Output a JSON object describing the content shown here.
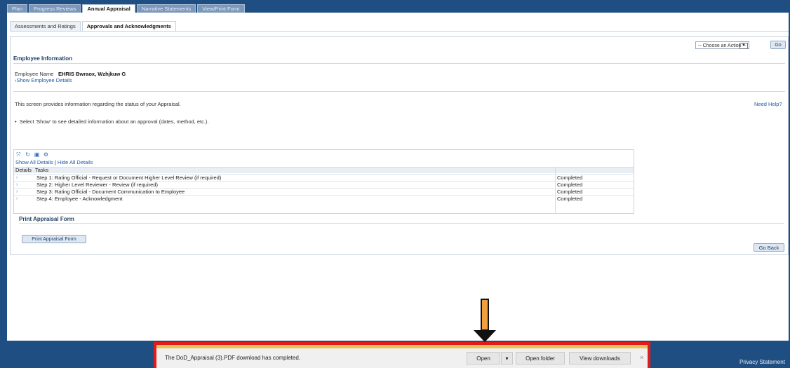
{
  "main_tabs": [
    "Plan",
    "Progress Reviews",
    "Annual Appraisal",
    "Narrative Statements",
    "View/Print Form"
  ],
  "active_main_tab": "Annual Appraisal",
  "sub_tabs": [
    "Assessments and Ratings",
    "Approvals and Acknowledgments"
  ],
  "actions": {
    "select_value": "-- Choose an Action --",
    "go_label": "Go"
  },
  "employee": {
    "section_title": "Employee Information",
    "name_label": "Employee Name",
    "name_value": "EHRIS Bwraox, Wzhjkuw G",
    "details_link": "Show Employee Details"
  },
  "info": {
    "description": "This screen provides information regarding the status of your Appraisal.",
    "need_help": "Need Help?",
    "bullet": "Select 'Show' to see detailed information about an approval (dates, method, etc.)."
  },
  "table": {
    "show_all": "Show All Details",
    "separator": "|",
    "hide_all": "Hide All Details",
    "headers": [
      "Details",
      "Tasks"
    ],
    "rows": [
      {
        "task": "Step 1:  Rating Official - Request or Document Higher Level Review (if required)",
        "status": "Completed"
      },
      {
        "task": "Step 2:  Higher Level Reviewer - Review (if required)",
        "status": "Completed"
      },
      {
        "task": "Step 3:  Rating Official - Document Communication to Employee",
        "status": "Completed"
      },
      {
        "task": "Step 4:  Employee - Acknowledgment",
        "status": "Completed"
      }
    ]
  },
  "print_section": {
    "title": "Print Appraisal Form",
    "button": "Print Appraisal Form"
  },
  "go_back": "Go Back",
  "footer": {
    "privacy": "Privacy Statement"
  },
  "download": {
    "message": "The DoD_Appraisal (3).PDF download has completed.",
    "open": "Open",
    "open_folder": "Open folder",
    "view_downloads": "View downloads",
    "close": "×"
  },
  "colors": {
    "header_blue": "#1f4f82",
    "highlight_red": "#e21b1b",
    "arrow_orange": "#f0a040"
  }
}
